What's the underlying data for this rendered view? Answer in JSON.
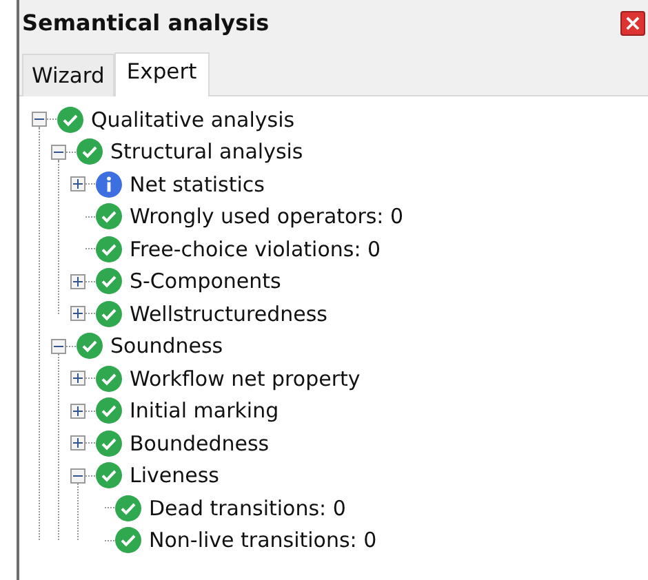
{
  "panel": {
    "title": "Semantical analysis",
    "close": "×"
  },
  "tabs": [
    {
      "label": "Wizard",
      "selected": false
    },
    {
      "label": "Expert",
      "selected": true
    }
  ],
  "tree": [
    {
      "label": "Qualitative analysis",
      "info": false,
      "expandable": true,
      "expanded": true,
      "children": [
        {
          "label": "Structural analysis",
          "info": false,
          "expandable": true,
          "expanded": true,
          "children": [
            {
              "label": "Net statistics",
              "info": true,
              "expandable": true,
              "expanded": false
            },
            {
              "label": "Wrongly used operators: 0",
              "info": false,
              "expandable": false
            },
            {
              "label": "Free-choice violations: 0",
              "info": false,
              "expandable": false
            },
            {
              "label": "S-Components",
              "info": false,
              "expandable": true,
              "expanded": false
            },
            {
              "label": "Wellstructuredness",
              "info": false,
              "expandable": true,
              "expanded": false
            }
          ]
        },
        {
          "label": "Soundness",
          "info": false,
          "expandable": true,
          "expanded": true,
          "children": [
            {
              "label": "Workflow net property",
              "info": false,
              "expandable": true,
              "expanded": false
            },
            {
              "label": "Initial marking",
              "info": false,
              "expandable": true,
              "expanded": false
            },
            {
              "label": "Boundedness",
              "info": false,
              "expandable": true,
              "expanded": false
            },
            {
              "label": "Liveness",
              "info": false,
              "expandable": true,
              "expanded": true,
              "children": [
                {
                  "label": "Dead transitions: 0",
                  "info": false,
                  "expandable": false
                },
                {
                  "label": "Non-live transitions: 0",
                  "info": false,
                  "expandable": false
                }
              ]
            }
          ]
        }
      ]
    }
  ]
}
